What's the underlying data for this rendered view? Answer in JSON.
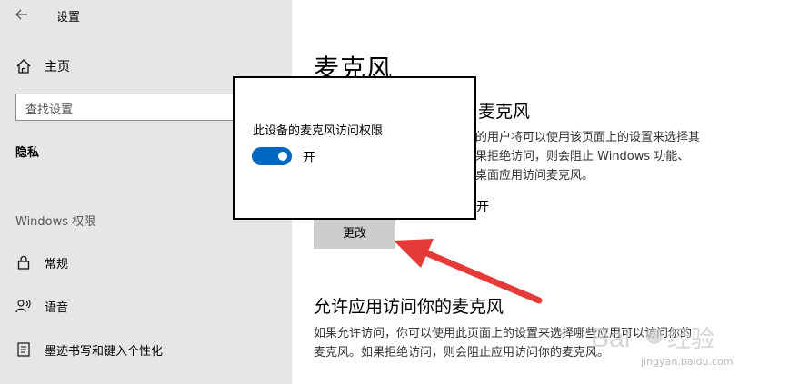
{
  "window": {
    "title": "设置",
    "back_icon": "arrow-left-icon"
  },
  "sidebar": {
    "home_label": "主页",
    "search_placeholder": "查找设置",
    "section_privacy": "隐私",
    "section_windows": "Windows 权限",
    "items": [
      {
        "label": "常规",
        "icon": "lock-icon"
      },
      {
        "label": "语音",
        "icon": "speech-icon"
      },
      {
        "label": "墨迹书写和键入个性化",
        "icon": "inking-icon"
      }
    ]
  },
  "main": {
    "title": "麦克风",
    "section1_heading": "麦克风",
    "section1_desc_lines": [
      "的用户将可以使用该页面上的设置来选择其",
      "果拒绝访问，则会阻止 Windows 功能、",
      "桌面应用访问麦克风。"
    ],
    "status_tail": "开",
    "change_button": "更改",
    "section2_heading": "允许应用访问你的麦克风",
    "section2_desc_lines": [
      "如果允许访问，你可以使用此页面上的设置来选择哪些应用可以访问你的",
      "麦克风。如果拒绝访问，则会阻止应用访问你的麦克风。"
    ]
  },
  "popup": {
    "title": "此设备的麦克风访问权限",
    "toggle_state": "on",
    "toggle_label": "开"
  },
  "colors": {
    "accent": "#0067c0",
    "sidebar_bg": "#e6e6e6",
    "button_bg": "#cccccc",
    "arrow": "#e53a37"
  },
  "watermark": {
    "text": "jingyan.baidu.com"
  }
}
